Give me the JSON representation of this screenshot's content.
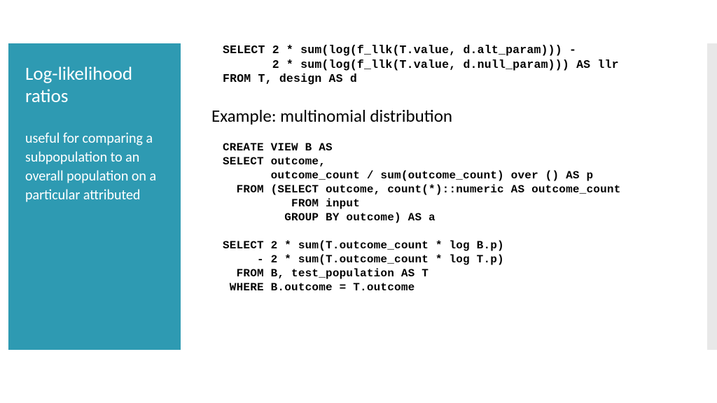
{
  "sidebar": {
    "title": "Log-likelihood ratios",
    "subtitle": "useful for comparing a subpopulation to an overall population on a particular attributed"
  },
  "code_top_lines": [
    "SELECT 2 * sum(log(f_llk(T.value, d.alt_param))) -",
    "       2 * sum(log(f_llk(T.value, d.null_param))) AS llr",
    "FROM T, design AS d"
  ],
  "example_heading": "Example: multinomial distribution",
  "code_bottom_lines": [
    "CREATE VIEW B AS",
    "SELECT outcome,",
    "       outcome_count / sum(outcome_count) over () AS p",
    "  FROM (SELECT outcome, count(*)::numeric AS outcome_count",
    "          FROM input",
    "         GROUP BY outcome) AS a",
    "",
    "SELECT 2 * sum(T.outcome_count * log B.p)",
    "     - 2 * sum(T.outcome_count * log T.p)",
    "  FROM B, test_population AS T",
    " WHERE B.outcome = T.outcome"
  ]
}
